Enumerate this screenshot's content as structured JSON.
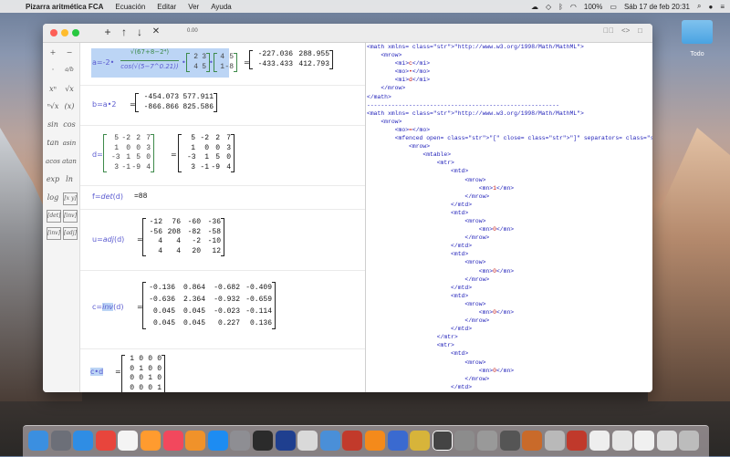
{
  "menubar": {
    "app_name": "Pizarra aritmética FCA",
    "items": [
      "Ecuación",
      "Editar",
      "Ver",
      "Ayuda"
    ],
    "battery": "100%",
    "datetime": "Sáb 17 de feb  20:31"
  },
  "desktop": {
    "folder_label": "Todo"
  },
  "toolbar": {
    "add": "+",
    "up": "↑",
    "down": "↓",
    "delete": "✕",
    "value": "0.00",
    "right_icons": [
      "▷⃒",
      "<>",
      "□"
    ]
  },
  "palette": {
    "items": [
      "+",
      "−",
      "·",
      "a/b",
      "xⁿ",
      "√x",
      "ⁿ√x",
      "(x)",
      "sin",
      "cos",
      "tan",
      "asin",
      "acos",
      "atan",
      "exp",
      "ln",
      "log",
      "[x y]",
      "[det]",
      "[inv]",
      "[inv]",
      "[adj]"
    ]
  },
  "rows": [
    {
      "lhs": "a=-2•",
      "label": "a",
      "result": [
        [
          "-227.036",
          "288.955"
        ],
        [
          "-433.433",
          "412.793"
        ]
      ]
    },
    {
      "lhs": "b=a•2",
      "result": [
        [
          "-454.073",
          "577.911"
        ],
        [
          "-866.866",
          "825.586"
        ]
      ]
    },
    {
      "lhs": "d=",
      "input": [
        [
          "5",
          "-2",
          "2",
          "7"
        ],
        [
          "1",
          "0",
          "0",
          "3"
        ],
        [
          "-3",
          "1",
          "5",
          "0"
        ],
        [
          "3",
          "-1",
          "-9",
          "4"
        ]
      ],
      "result": [
        [
          "5",
          "-2",
          "2",
          "7"
        ],
        [
          "1",
          "0",
          "0",
          "3"
        ],
        [
          "-3",
          "1",
          "5",
          "0"
        ],
        [
          "3",
          "-1",
          "-9",
          "4"
        ]
      ]
    },
    {
      "lhs_pre": "f=",
      "lhs_fn": "det",
      "lhs_post": "(d)",
      "result_text": "=88"
    },
    {
      "lhs_pre": "u=",
      "lhs_fn": "adj",
      "lhs_post": "(d)",
      "result": [
        [
          "-12",
          "76",
          "-60",
          "-36"
        ],
        [
          "-56",
          "208",
          "-82",
          "-58"
        ],
        [
          "4",
          "4",
          "-2",
          "-10"
        ],
        [
          "4",
          "4",
          "20",
          "12"
        ]
      ]
    },
    {
      "lhs_pre": "c=",
      "lhs_fn": "inv",
      "lhs_post": "(d)",
      "result": [
        [
          "-0.136",
          "0.864",
          "-0.682",
          "-0.409"
        ],
        [
          "-0.636",
          "2.364",
          "-0.932",
          "-0.659"
        ],
        [
          "0.045",
          "0.045",
          "-0.023",
          "-0.114"
        ],
        [
          "0.045",
          "0.045",
          "0.227",
          "0.136"
        ]
      ]
    },
    {
      "lhs": "c•d",
      "result": [
        [
          "1",
          "0",
          "0",
          "0"
        ],
        [
          "0",
          "1",
          "0",
          "0"
        ],
        [
          "0",
          "0",
          "1",
          "0"
        ],
        [
          "0",
          "0",
          "0",
          "1"
        ]
      ]
    }
  ],
  "row1_parts": {
    "frac_num": "√(67+8−2⁴)",
    "frac_den": "cos(√(5−7^0.21))",
    "m1": [
      [
        "2",
        "3"
      ],
      [
        "4",
        "5"
      ]
    ],
    "m2": [
      [
        "4",
        "5"
      ],
      [
        "1",
        "-8"
      ]
    ]
  },
  "xml_lines": [
    "<math xmlns=\"http://www.w3.org/1998/Math/MathML\">",
    "    <mrow>",
    "        <mi>c</mi>",
    "        <mo>•</mo>",
    "        <mi>d</mi>",
    "    </mrow>",
    "</math>",
    "",
    "-------------------------------------------------------",
    "<math xmlns=\"http://www.w3.org/1998/Math/MathML\">",
    "    <mrow>",
    "        <mo>=</mo>",
    "        <mfenced open=\"[\" close=\"]\" separators=\",",
    "            <mrow>",
    "                <mtable>",
    "                    <mtr>",
    "                        <mtd>",
    "                            <mrow>",
    "                                <mn>1</mn>",
    "                            </mrow>",
    "                        </mtd>",
    "                        <mtd>",
    "                            <mrow>",
    "                                <mn>0</mn>",
    "                            </mrow>",
    "                        </mtd>",
    "                        <mtd>",
    "                            <mrow>",
    "                                <mn>0</mn>",
    "                            </mrow>",
    "                        </mtd>",
    "                        <mtd>",
    "                            <mrow>",
    "                                <mn>0</mn>",
    "                            </mrow>",
    "                        </mtd>",
    "                    </mtr>",
    "                    <mtr>",
    "                        <mtd>",
    "                            <mrow>",
    "                                <mn>0</mn>",
    "                            </mrow>",
    "                        </mtd>"
  ],
  "dock": {
    "icons": [
      "finder-icon",
      "launchpad-icon",
      "safari-icon",
      "chrome-icon",
      "calendar-icon",
      "sublime-icon",
      "music-icon",
      "books-icon",
      "appstore-icon",
      "settings-icon",
      "terminal-icon",
      "unetcams-icon",
      "scanner-icon",
      "folder-icon",
      "ftp-icon",
      "vlc-icon",
      "tool-icon",
      "colors-icon",
      "pizarra-icon",
      "app-icon",
      "app-icon",
      "app-icon",
      "chess-icon",
      "mathml-icon",
      "pdf-icon",
      "doc-icon",
      "doc-icon",
      "doc-icon",
      "doc-icon",
      "trash-icon"
    ]
  },
  "colors": {
    "expr": "#5b5bd0",
    "xml_tag": "#1d1db8",
    "xml_string": "#c41a16",
    "highlight": "#bcd5f5",
    "matrix_green": "#3d8a4a"
  }
}
